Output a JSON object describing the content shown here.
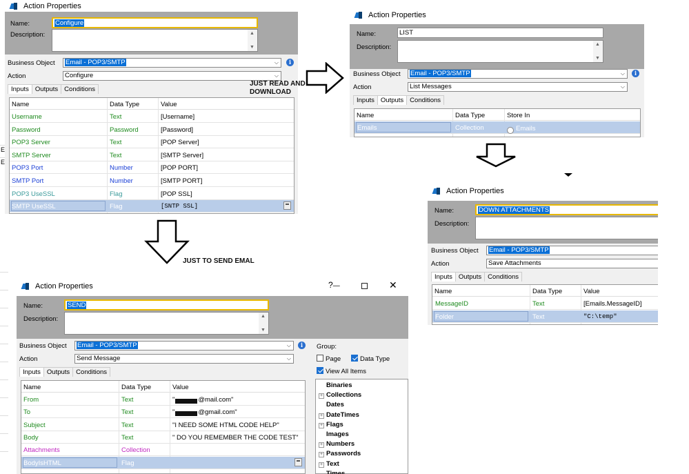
{
  "annotations": {
    "read_download_line1": "JUST READ AND",
    "read_download_line2": "DOWNLOAD",
    "send": "JUST TO SEND EMAL"
  },
  "common": {
    "window_title": "Action Properties",
    "name_label": "Name:",
    "description_label": "Description:",
    "business_object_label": "Business Object",
    "action_label": "Action",
    "tab_inputs": "Inputs",
    "tab_outputs": "Outputs",
    "tab_conditions": "Conditions",
    "col_name": "Name",
    "col_data_type": "Data Type",
    "col_value": "Value",
    "col_store_in": "Store In",
    "business_object_value": "Email - POP3/SMTP"
  },
  "configure": {
    "name_value": "Configure",
    "action_value": "Configure",
    "rows": [
      {
        "name": "Username",
        "type": "Text",
        "value": "[Username]",
        "color": "green"
      },
      {
        "name": "Password",
        "type": "Password",
        "value": "[Password]",
        "color": "green"
      },
      {
        "name": "POP3 Server",
        "type": "Text",
        "value": "[POP Server]",
        "color": "green"
      },
      {
        "name": "SMTP Server",
        "type": "Text",
        "value": "[SMTP Server]",
        "color": "green"
      },
      {
        "name": "POP3 Port",
        "type": "Number",
        "value": "[POP PORT]",
        "color": "blue"
      },
      {
        "name": "SMTP Port",
        "type": "Number",
        "value": "[SMTP PORT]",
        "color": "blue"
      },
      {
        "name": "POP3 UseSSL",
        "type": "Flag",
        "value": "[POP SSL]",
        "color": "teal"
      },
      {
        "name": "SMTP UseSSL",
        "type": "Flag",
        "value": "[SNTP SSL]",
        "color": "teal"
      }
    ]
  },
  "list": {
    "name_value": "LIST",
    "action_value": "List Messages",
    "rows": [
      {
        "name": "Emails",
        "type": "Collection",
        "store_in": "Emails"
      }
    ]
  },
  "download": {
    "name_value": "DOWN ATTACHMENTS",
    "action_value": "Save Attachments",
    "rows": [
      {
        "name": "MessageID",
        "type": "Text",
        "value": "[Emails.MessageID]"
      },
      {
        "name": "Folder",
        "type": "Text",
        "value": "\"C:\\temp\""
      }
    ]
  },
  "send": {
    "name_value": "SEND",
    "action_value": "Send Message",
    "help_glyph": "?",
    "rows": [
      {
        "name": "From",
        "type": "Text",
        "value_prefix": "\"",
        "value_suffix": "@mail.com\"",
        "color": "green"
      },
      {
        "name": "To",
        "type": "Text",
        "value_prefix": "\"",
        "value_suffix": "@gmail.com\"",
        "color": "green"
      },
      {
        "name": "Subject",
        "type": "Text",
        "value": "\"I NEED SOME HTML CODE HELP\"",
        "color": "green"
      },
      {
        "name": "Body",
        "type": "Text",
        "value": "\" DO YOU REMEMBER THE CODE TEST\"",
        "color": "green"
      },
      {
        "name": "Attachments",
        "type": "Collection",
        "value": "",
        "color": "magenta"
      },
      {
        "name": "BodyIsHTML",
        "type": "Flag",
        "value": "",
        "color": "teal"
      }
    ],
    "group_label": "Group:",
    "opt_page": "Page",
    "opt_data_type": "Data Type",
    "opt_view_all": "View All Items",
    "tree": [
      "Binaries",
      "Collections",
      "Dates",
      "DateTimes",
      "Flags",
      "Images",
      "Numbers",
      "Passwords",
      "Text",
      "Times"
    ],
    "tree_expandable": [
      false,
      true,
      false,
      true,
      true,
      false,
      true,
      true,
      true,
      false
    ]
  }
}
